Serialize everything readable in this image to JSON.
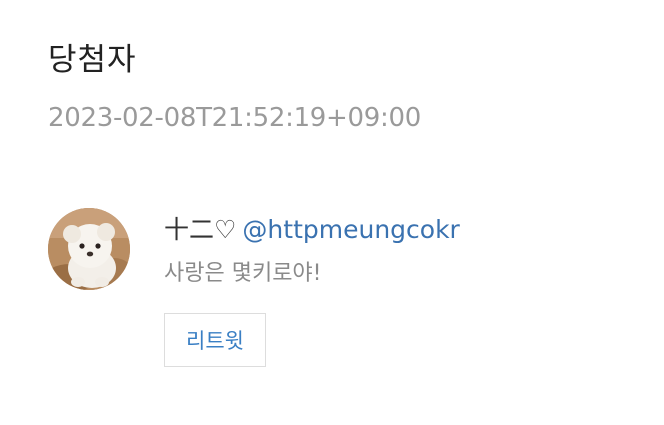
{
  "header": {
    "title": "당첨자",
    "timestamp": "2023-02-08T21:52:19+09:00"
  },
  "winner": {
    "display_name": "十二♡",
    "handle": "@httpmeungcokr",
    "message": "사랑은 몇키로야!",
    "avatar_icon": "white-puppy-avatar"
  },
  "actions": {
    "retweet_label": "리트윗"
  },
  "colors": {
    "text": "#222222",
    "muted": "#9a9a9a",
    "link": "#3a72b0",
    "button_text": "#3a7fc4",
    "button_border": "#dddddd"
  }
}
